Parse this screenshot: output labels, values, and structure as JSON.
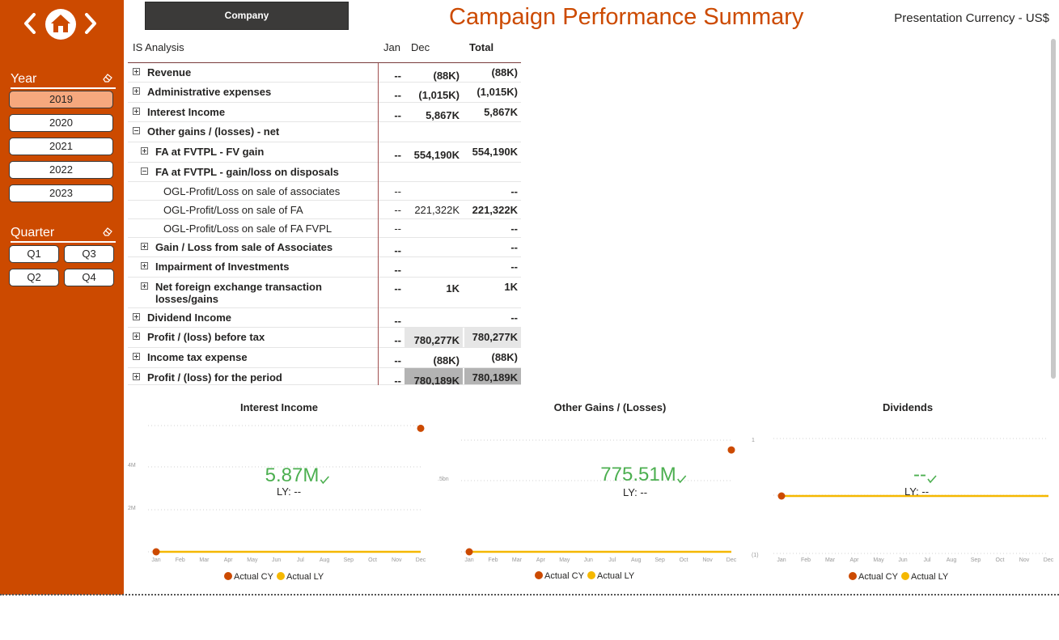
{
  "header": {
    "company_button": "Company",
    "title": "Campaign Performance Summary",
    "currency": "Presentation Currency - US$"
  },
  "sidebar": {
    "year_title": "Year",
    "years": [
      "2019",
      "2020",
      "2021",
      "2022",
      "2023"
    ],
    "selected_year": "2019",
    "quarter_title": "Quarter",
    "quarters": [
      "Q1",
      "Q3",
      "Q2",
      "Q4"
    ]
  },
  "matrix": {
    "columns": {
      "label": "IS Analysis",
      "jan": "Jan",
      "dec": "Dec",
      "total": "Total"
    },
    "rows": [
      {
        "label": "Revenue",
        "jan": "--",
        "dec": "(88K)",
        "total": "(88K)"
      },
      {
        "label": "Administrative expenses",
        "jan": "--",
        "dec": "(1,015K)",
        "total": "(1,015K)"
      },
      {
        "label": "Interest Income",
        "jan": "--",
        "dec": "5,867K",
        "total": "5,867K"
      },
      {
        "label": "Other gains / (losses) - net",
        "jan": "",
        "dec": "",
        "total": ""
      },
      {
        "label": "FA at FVTPL - FV gain",
        "jan": "--",
        "dec": "554,190K",
        "total": "554,190K"
      },
      {
        "label": "FA at FVTPL - gain/loss on disposals",
        "jan": "",
        "dec": "",
        "total": ""
      },
      {
        "label": "OGL-Profit/Loss on sale of associates",
        "jan": "--",
        "dec": "",
        "total": "--"
      },
      {
        "label": "OGL-Profit/Loss on sale of FA",
        "jan": "--",
        "dec": "221,322K",
        "total": "221,322K"
      },
      {
        "label": "OGL-Profit/Loss on sale of FA FVPL",
        "jan": "--",
        "dec": "",
        "total": "--"
      },
      {
        "label": "Gain / Loss from sale of Associates",
        "jan": "--",
        "dec": "",
        "total": "--"
      },
      {
        "label": "Impairment of Investments",
        "jan": "--",
        "dec": "",
        "total": "--"
      },
      {
        "label": "Net foreign exchange transaction",
        "label2": "losses/gains",
        "jan": "--",
        "dec": "1K",
        "total": "1K"
      },
      {
        "label": "Dividend Income",
        "jan": "--",
        "dec": "",
        "total": "--"
      },
      {
        "label": "Profit / (loss) before tax",
        "jan": "--",
        "dec": "780,277K",
        "total": "780,277K"
      },
      {
        "label": "Income tax expense",
        "jan": "--",
        "dec": "(88K)",
        "total": "(88K)"
      },
      {
        "label": "Profit / (loss) for the period",
        "jan": "--",
        "dec": "780,189K",
        "total": "780,189K"
      }
    ]
  },
  "colors": {
    "accent": "#cc4a00",
    "actual_cy": "#cc4a00",
    "actual_ly": "#f5b800",
    "kpi": "#4caf50"
  },
  "charts": {
    "months": [
      "Jan",
      "Feb",
      "Mar",
      "Apr",
      "May",
      "Jun",
      "Jul",
      "Aug",
      "Sep",
      "Oct",
      "Nov",
      "Dec"
    ],
    "legend_cy": "Actual CY",
    "legend_ly": "Actual LY",
    "interest": {
      "title": "Interest Income",
      "kpi": "5.87M",
      "ly": "LY: --",
      "ticks": [
        "4M",
        "2M"
      ]
    },
    "other": {
      "title": "Other Gains / (Losses)",
      "kpi": "775.51M",
      "ly": "LY: --",
      "ticks": [
        ".5bn"
      ]
    },
    "dividends": {
      "title": "Dividends",
      "kpi": "--",
      "ly": "LY: --",
      "ticks": [
        "1",
        "(1)"
      ]
    }
  },
  "chart_data": [
    {
      "type": "line",
      "title": "Interest Income",
      "x": [
        "Jan",
        "Feb",
        "Mar",
        "Apr",
        "May",
        "Jun",
        "Jul",
        "Aug",
        "Sep",
        "Oct",
        "Nov",
        "Dec"
      ],
      "series": [
        {
          "name": "Actual CY",
          "x": [
            "Jan",
            "Dec"
          ],
          "values": [
            0,
            5.87
          ]
        },
        {
          "name": "Actual LY",
          "values": [
            0,
            0,
            0,
            0,
            0,
            0,
            0,
            0,
            0,
            0,
            0,
            0
          ]
        }
      ],
      "ylabel": "",
      "ylim": [
        0,
        6
      ],
      "y_unit": "M"
    },
    {
      "type": "line",
      "title": "Other Gains / (Losses)",
      "x": [
        "Jan",
        "Feb",
        "Mar",
        "Apr",
        "May",
        "Jun",
        "Jul",
        "Aug",
        "Sep",
        "Oct",
        "Nov",
        "Dec"
      ],
      "series": [
        {
          "name": "Actual CY",
          "x": [
            "Jan",
            "Dec"
          ],
          "values": [
            0,
            0.7755
          ]
        },
        {
          "name": "Actual LY",
          "values": [
            0,
            0,
            0,
            0,
            0,
            0,
            0,
            0,
            0,
            0,
            0,
            0
          ]
        }
      ],
      "ylabel": "",
      "ylim": [
        0,
        0.85
      ],
      "y_unit": "bn"
    },
    {
      "type": "line",
      "title": "Dividends",
      "x": [
        "Jan",
        "Feb",
        "Mar",
        "Apr",
        "May",
        "Jun",
        "Jul",
        "Aug",
        "Sep",
        "Oct",
        "Nov",
        "Dec"
      ],
      "series": [
        {
          "name": "Actual CY",
          "x": [
            "Jan"
          ],
          "values": [
            0
          ]
        },
        {
          "name": "Actual LY",
          "values": [
            0,
            0,
            0,
            0,
            0,
            0,
            0,
            0,
            0,
            0,
            0,
            0
          ]
        }
      ],
      "ylabel": "",
      "ylim": [
        -1,
        1
      ]
    }
  ]
}
